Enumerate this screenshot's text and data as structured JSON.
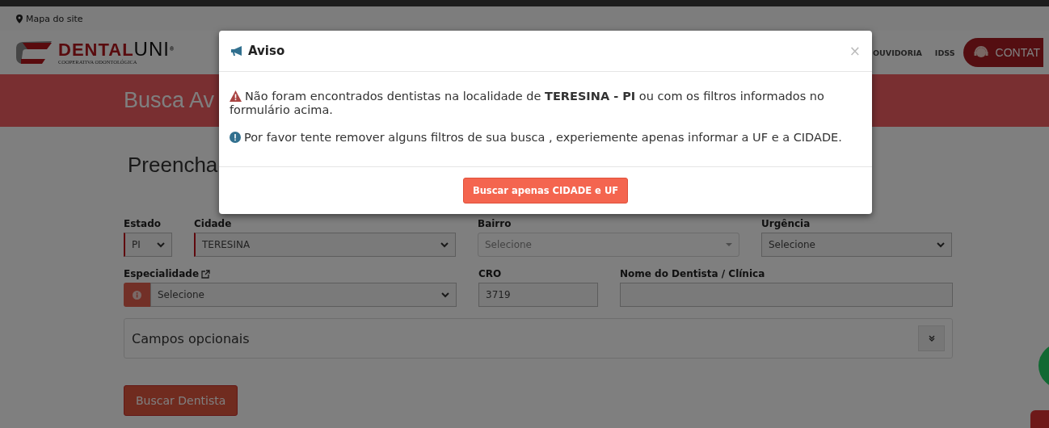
{
  "top_bar": {
    "sitemap_link": "Mapa do site"
  },
  "header": {
    "logo": {
      "brand_first": "DENTAL",
      "brand_second": "UNI",
      "registered": "®",
      "tagline": "COOPERATIVA ODONTOLÓGICA"
    },
    "nav": [
      "OUVIDORIA",
      "IDSS"
    ],
    "contact_button": "CONTAT"
  },
  "banner": {
    "title": "Busca Av"
  },
  "form": {
    "heading": "Preencha",
    "fields": [
      {
        "label": "Estado",
        "kind": "select",
        "value": "PI",
        "required": true
      },
      {
        "label": "Cidade",
        "kind": "select",
        "value": "TERESINA",
        "required": true
      },
      {
        "label": "Bairro",
        "kind": "combobox",
        "placeholder": "Selecione",
        "required": false
      },
      {
        "label": "Urgência",
        "kind": "select",
        "value": "Selecione",
        "required": false
      },
      {
        "label": "Especialidade",
        "kind": "select",
        "value": "Selecione",
        "required": false,
        "external_link": true,
        "info_addon": true
      },
      {
        "label": "CRO",
        "kind": "input",
        "value": "3719",
        "required": false
      },
      {
        "label": "Nome do Dentista / Clínica",
        "kind": "input",
        "required": false
      }
    ],
    "optional_panel": {
      "title": "Campos opcionais",
      "expanded": false
    },
    "submit_button": "Buscar Dentista"
  },
  "modal": {
    "title": "Aviso",
    "close": "×",
    "messages": [
      {
        "kind": "warning",
        "text": "Não foram encontrados dentistas na localidade de **TERESINA - PI** ou com os filtros informados no formulário acima."
      },
      {
        "kind": "info",
        "text": "Por favor tente remover alguns filtros de sua busca , experiemente apenas informar a UF e a CIDADE."
      }
    ],
    "button": "Buscar apenas CIDADE e UF"
  }
}
